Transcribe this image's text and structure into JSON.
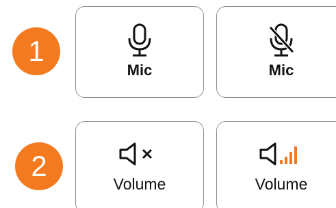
{
  "rows": [
    {
      "badge": "1"
    },
    {
      "badge": "2"
    }
  ],
  "cards": {
    "mic_on": {
      "label": "Mic",
      "icon": "microphone-icon"
    },
    "mic_off": {
      "label": "Mic",
      "icon": "microphone-muted-icon"
    },
    "vol_mute": {
      "label": "Volume",
      "icon": "speaker-muted-icon"
    },
    "vol_on": {
      "label": "Volume",
      "icon": "speaker-volume-bars-icon"
    }
  },
  "colors": {
    "badge": "#f47a20",
    "volume_bars": "#f47a20",
    "icon_stroke": "#111111",
    "card_border": "#8f8f8f"
  }
}
